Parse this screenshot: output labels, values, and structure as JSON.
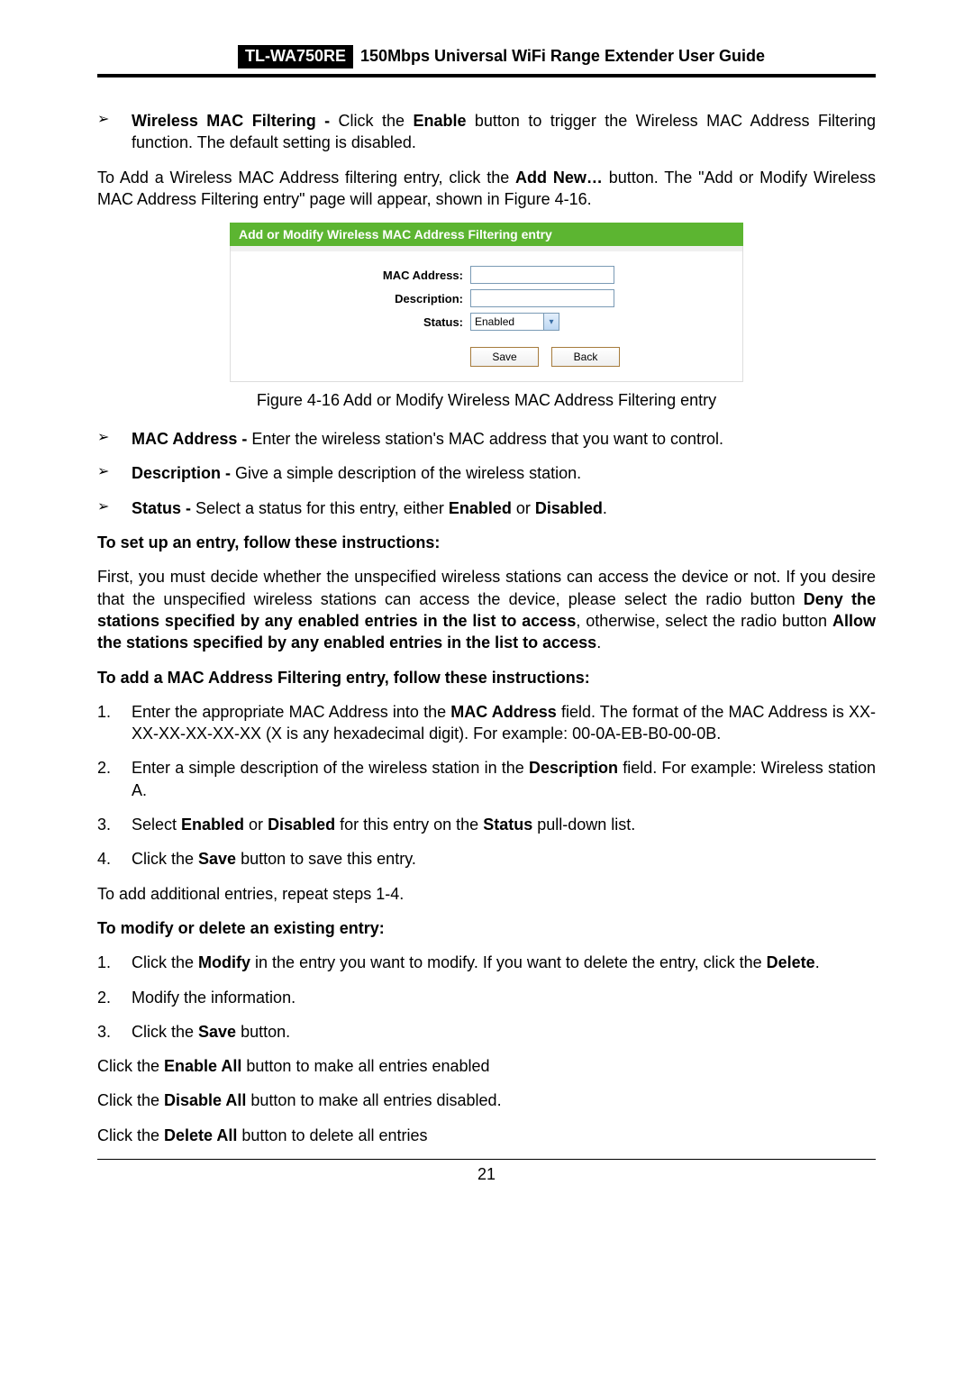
{
  "header": {
    "model": "TL-WA750RE",
    "title": "150Mbps Universal WiFi Range Extender User Guide"
  },
  "bullets_top": [
    "<b>Wireless MAC Filtering -</b> Click the <b>Enable</b> button to trigger the Wireless MAC Address Filtering function. The default setting is disabled."
  ],
  "intro_para": "To Add a Wireless MAC Address filtering entry, click the <b>Add New…</b> button. The \"Add or Modify Wireless MAC Address Filtering entry\" page will appear, shown in Figure 4-16.",
  "figure": {
    "title": "Add or Modify Wireless MAC Address Filtering entry",
    "fields": {
      "mac_label": "MAC Address:",
      "mac_value": "",
      "desc_label": "Description:",
      "desc_value": "",
      "status_label": "Status:",
      "status_value": "Enabled"
    },
    "buttons": {
      "save": "Save",
      "back": "Back"
    },
    "caption": "Figure 4-16 Add or Modify Wireless MAC Address Filtering entry"
  },
  "bullets_mid": [
    "<b>MAC Address -</b> Enter the wireless station's MAC address that you want to control.",
    "<b>Description -</b> Give a simple description of the wireless station.",
    "<b>Status -</b> Select a status for this entry, either <b>Enabled</b> or <b>Disabled</b>."
  ],
  "setup_heading": "To set up an entry, follow these instructions:",
  "setup_para": "First, you must decide whether the unspecified wireless stations can access the device or not. If you desire that the unspecified wireless stations can access the device, please select the radio button <b>Deny the stations specified by any enabled entries in the list to access</b>, otherwise, select the radio button <b>Allow the stations specified by any enabled entries in the list to access</b>.",
  "add_heading": "To add a MAC Address Filtering entry, follow these instructions:",
  "add_steps": [
    "Enter the appropriate MAC Address into the <b>MAC Address</b> field. The format of the MAC Address is XX-XX-XX-XX-XX-XX (X is any hexadecimal digit). For example: 00-0A-EB-B0-00-0B.",
    "Enter a simple description of the wireless station in the <b>Description</b> field. For example: Wireless station A.",
    "Select <b>Enabled</b> or <b>Disabled</b> for this entry on the <b>Status</b> pull-down list.",
    "Click the <b>Save</b> button to save this entry."
  ],
  "add_after": "To add additional entries, repeat steps 1-4.",
  "mod_heading": "To modify or delete an existing entry:",
  "mod_steps": [
    "Click the <b>Modify</b> in the entry you want to modify. If you want to delete the entry, click the <b>Delete</b>.",
    "Modify the information.",
    "Click the <b>Save</b> button."
  ],
  "tail_paras": [
    "Click the <b>Enable All</b> button to make all entries enabled",
    "Click the <b>Disable All</b> button to make all entries disabled.",
    "Click the <b>Delete All</b> button to delete all entries"
  ],
  "page_number": "21"
}
